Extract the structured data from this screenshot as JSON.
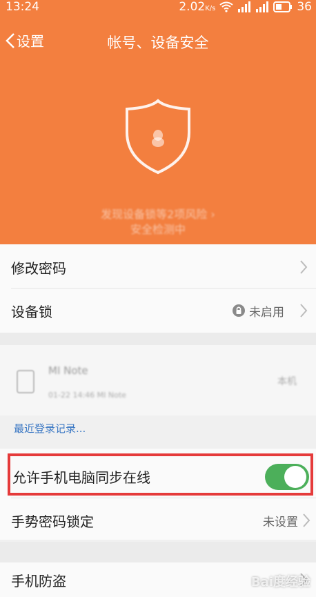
{
  "status_bar": {
    "time": "13:24",
    "speed": "2.02",
    "speed_unit": "K/s",
    "battery": "36"
  },
  "nav": {
    "back_label": "设置",
    "title": "帐号、设备安全"
  },
  "banner": {
    "risk_line1": "发现设备锁等2项风险",
    "risk_line2": "安全检测中"
  },
  "rows": {
    "change_password": "修改密码",
    "device_lock": {
      "label": "设备锁",
      "value": "未启用"
    },
    "sync_online": {
      "label": "允许手机电脑同步在线",
      "enabled": true
    },
    "gesture_lock": {
      "label": "手势密码锁定",
      "value": "未设置"
    },
    "anti_theft": "手机防盗"
  },
  "device": {
    "name": "MI Note",
    "time": "01-22 14:46 MI Note",
    "tag": "本机"
  },
  "recent_login": "最近登录记录...",
  "watermark": "Bai度经验",
  "colors": {
    "header": "#f37f3f",
    "toggle_on": "#4caf5a",
    "link": "#3b78c4",
    "highlight": "#e53a3a"
  }
}
